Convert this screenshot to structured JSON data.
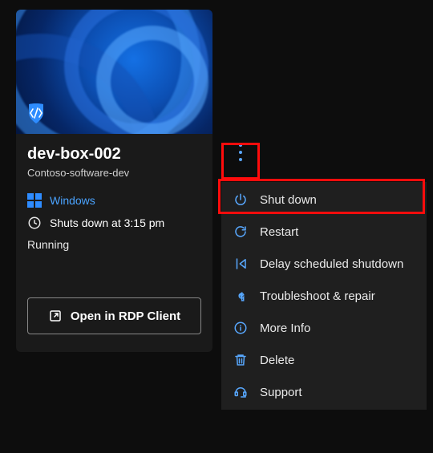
{
  "card": {
    "title": "dev-box-002",
    "subtitle": "Contoso-software-dev",
    "os_label": "Windows",
    "schedule": "Shuts down at 3:15 pm",
    "status": "Running",
    "open_button": "Open in RDP Client"
  },
  "menu": {
    "items": [
      {
        "icon": "power-icon",
        "label": "Shut down"
      },
      {
        "icon": "restart-icon",
        "label": "Restart"
      },
      {
        "icon": "delay-icon",
        "label": "Delay scheduled shutdown"
      },
      {
        "icon": "wrench-icon",
        "label": "Troubleshoot & repair"
      },
      {
        "icon": "info-icon",
        "label": "More Info"
      },
      {
        "icon": "trash-icon",
        "label": "Delete"
      },
      {
        "icon": "headset-icon",
        "label": "Support"
      }
    ]
  },
  "highlights": {
    "kebab": true,
    "shutdown": true
  }
}
